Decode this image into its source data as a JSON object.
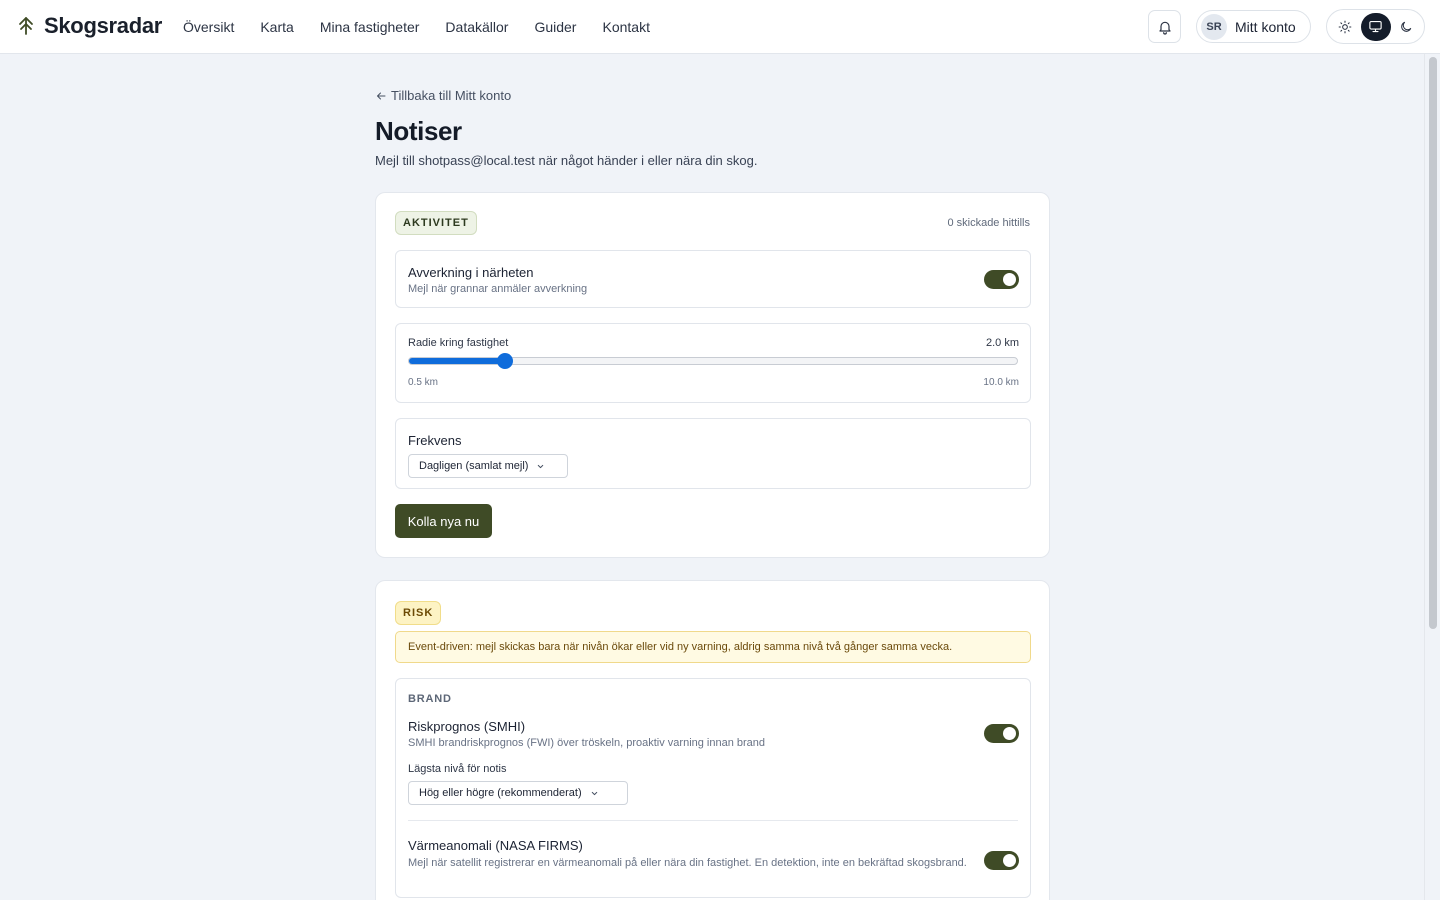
{
  "header": {
    "brand": "Skogsradar",
    "nav": [
      "Översikt",
      "Karta",
      "Mina fastigheter",
      "Datakällor",
      "Guider",
      "Kontakt"
    ],
    "avatar_initials": "SR",
    "account_label": "Mitt konto",
    "theme_options": [
      "sun-icon",
      "monitor-icon",
      "moon-icon"
    ],
    "active_theme": "monitor-icon"
  },
  "page": {
    "back_link": "Tillbaka till Mitt konto",
    "title": "Notiser",
    "subtitle": "Mejl till shotpass@local.test när något händer i eller nära din skog."
  },
  "activity": {
    "badge": "AKTIVITET",
    "sent_count": "0 skickade hittills",
    "harvest": {
      "title": "Avverkning i närheten",
      "description": "Mejl när grannar anmäler avverkning",
      "enabled": true
    },
    "radius": {
      "label": "Radie kring fastighet",
      "value_text": "2.0 km",
      "value": 2.0,
      "min": 0.5,
      "max": 10.0,
      "min_label": "0.5 km",
      "max_label": "10.0 km"
    },
    "frequency": {
      "label": "Frekvens",
      "selected": "Dagligen (samlat mejl)"
    },
    "check_button": "Kolla nya nu"
  },
  "risk": {
    "badge": "RISK",
    "notice": "Event-driven: mejl skickas bara när nivån ökar eller vid ny varning, aldrig samma nivå två gånger samma vecka.",
    "fire": {
      "section_label": "BRAND",
      "forecast": {
        "title": "Riskprognos (SMHI)",
        "description": "SMHI brandriskprognos (FWI) över tröskeln, proaktiv varning innan brand",
        "enabled": true,
        "min_level_label": "Lägsta nivå för notis",
        "min_level_selected": "Hög eller högre (rekommenderat)"
      },
      "anomaly": {
        "title": "Värmeanomali (NASA FIRMS)",
        "description": "Mejl när satellit registrerar en värmeanomali på eller nära din fastighet. En detektion, inte en bekräftad skogsbrand.",
        "enabled": true
      }
    }
  },
  "colors": {
    "accent_dark_green": "#3f4b26",
    "slider_blue": "#0f6cdb",
    "page_bg": "#f0f3f8"
  }
}
